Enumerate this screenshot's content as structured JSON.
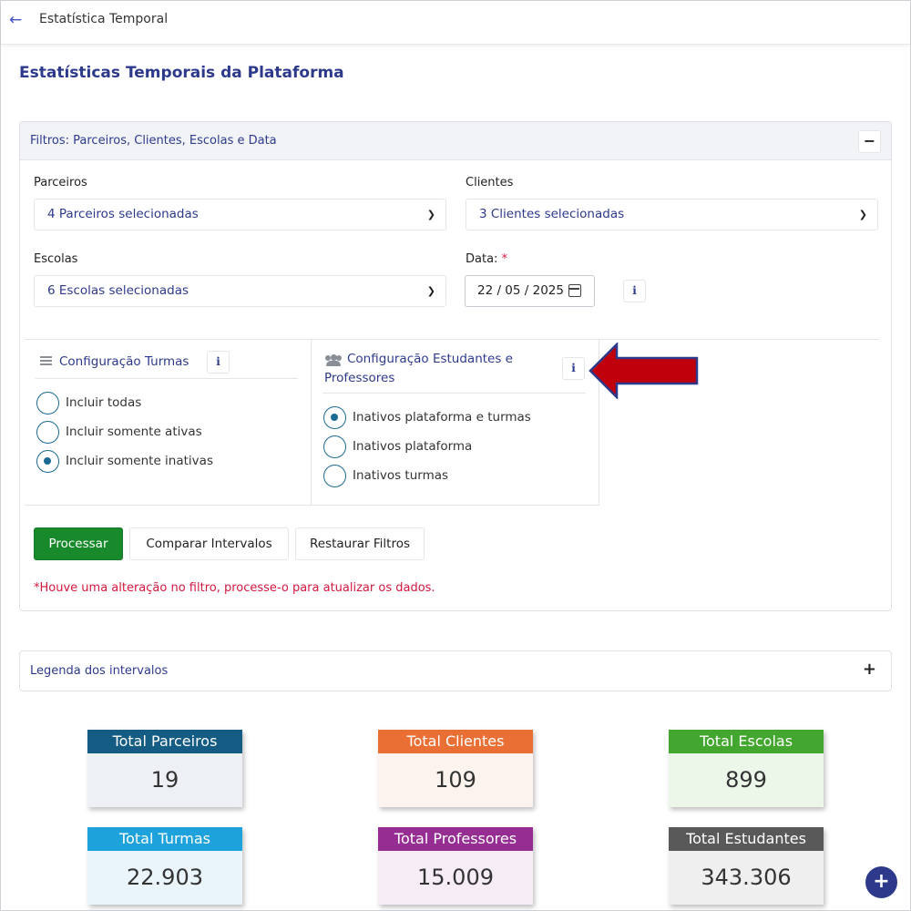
{
  "header": {
    "title": "Estatística Temporal",
    "back_icon": "arrow-left-icon"
  },
  "page_title": "Estatísticas Temporais da Plataforma",
  "filters": {
    "title": "Filtros: Parceiros, Clientes, Escolas e Data",
    "collapse_label": "−",
    "parceiros": {
      "label": "Parceiros",
      "value": "4 Parceiros selecionadas"
    },
    "clientes": {
      "label": "Clientes",
      "value": "3 Clientes selecionadas"
    },
    "escolas": {
      "label": "Escolas",
      "value": "6 Escolas selecionadas"
    },
    "data": {
      "label": "Data:",
      "required_mark": "*",
      "value": "22 / 05 / 2025"
    },
    "info_label": "i",
    "config_turmas": {
      "title": "Configuração Turmas",
      "options": [
        {
          "label": "Incluir todas",
          "checked": false
        },
        {
          "label": "Incluir somente ativas",
          "checked": false
        },
        {
          "label": "Incluir somente inativas",
          "checked": true
        }
      ]
    },
    "config_estudantes": {
      "title_line1": "Configuração Estudantes e",
      "title_line2": "Professores",
      "options": [
        {
          "label": "Inativos plataforma e turmas",
          "checked": true
        },
        {
          "label": "Inativos plataforma",
          "checked": false
        },
        {
          "label": "Inativos turmas",
          "checked": false
        }
      ]
    },
    "buttons": {
      "processar": "Processar",
      "comparar": "Comparar Intervalos",
      "restaurar": "Restaurar Filtros"
    },
    "warning": "*Houve uma alteração no filtro, processe-o para atualizar os dados."
  },
  "legend": {
    "title": "Legenda dos intervalos",
    "expand_label": "+"
  },
  "stats": [
    {
      "label": "Total Parceiros",
      "value": "19",
      "color": "#145c83",
      "bg": "#edf1f5"
    },
    {
      "label": "Total Clientes",
      "value": "109",
      "color": "#ea6f35",
      "bg": "#fdf3ee"
    },
    {
      "label": "Total Escolas",
      "value": "899",
      "color": "#43a72f",
      "bg": "#ecf7ea"
    },
    {
      "label": "Total Turmas",
      "value": "22.903",
      "color": "#1da2dc",
      "bg": "#e9f5fb"
    },
    {
      "label": "Total Professores",
      "value": "15.009",
      "color": "#962d93",
      "bg": "#f5ecf5"
    },
    {
      "label": "Total Estudantes",
      "value": "343.306",
      "color": "#595959",
      "bg": "#efefef"
    }
  ],
  "fab_label": "+",
  "colors": {
    "accent": "#2d3a8c",
    "primary_button": "#188a2c",
    "warning": "#d4173f",
    "arrow": "#c0000b"
  }
}
